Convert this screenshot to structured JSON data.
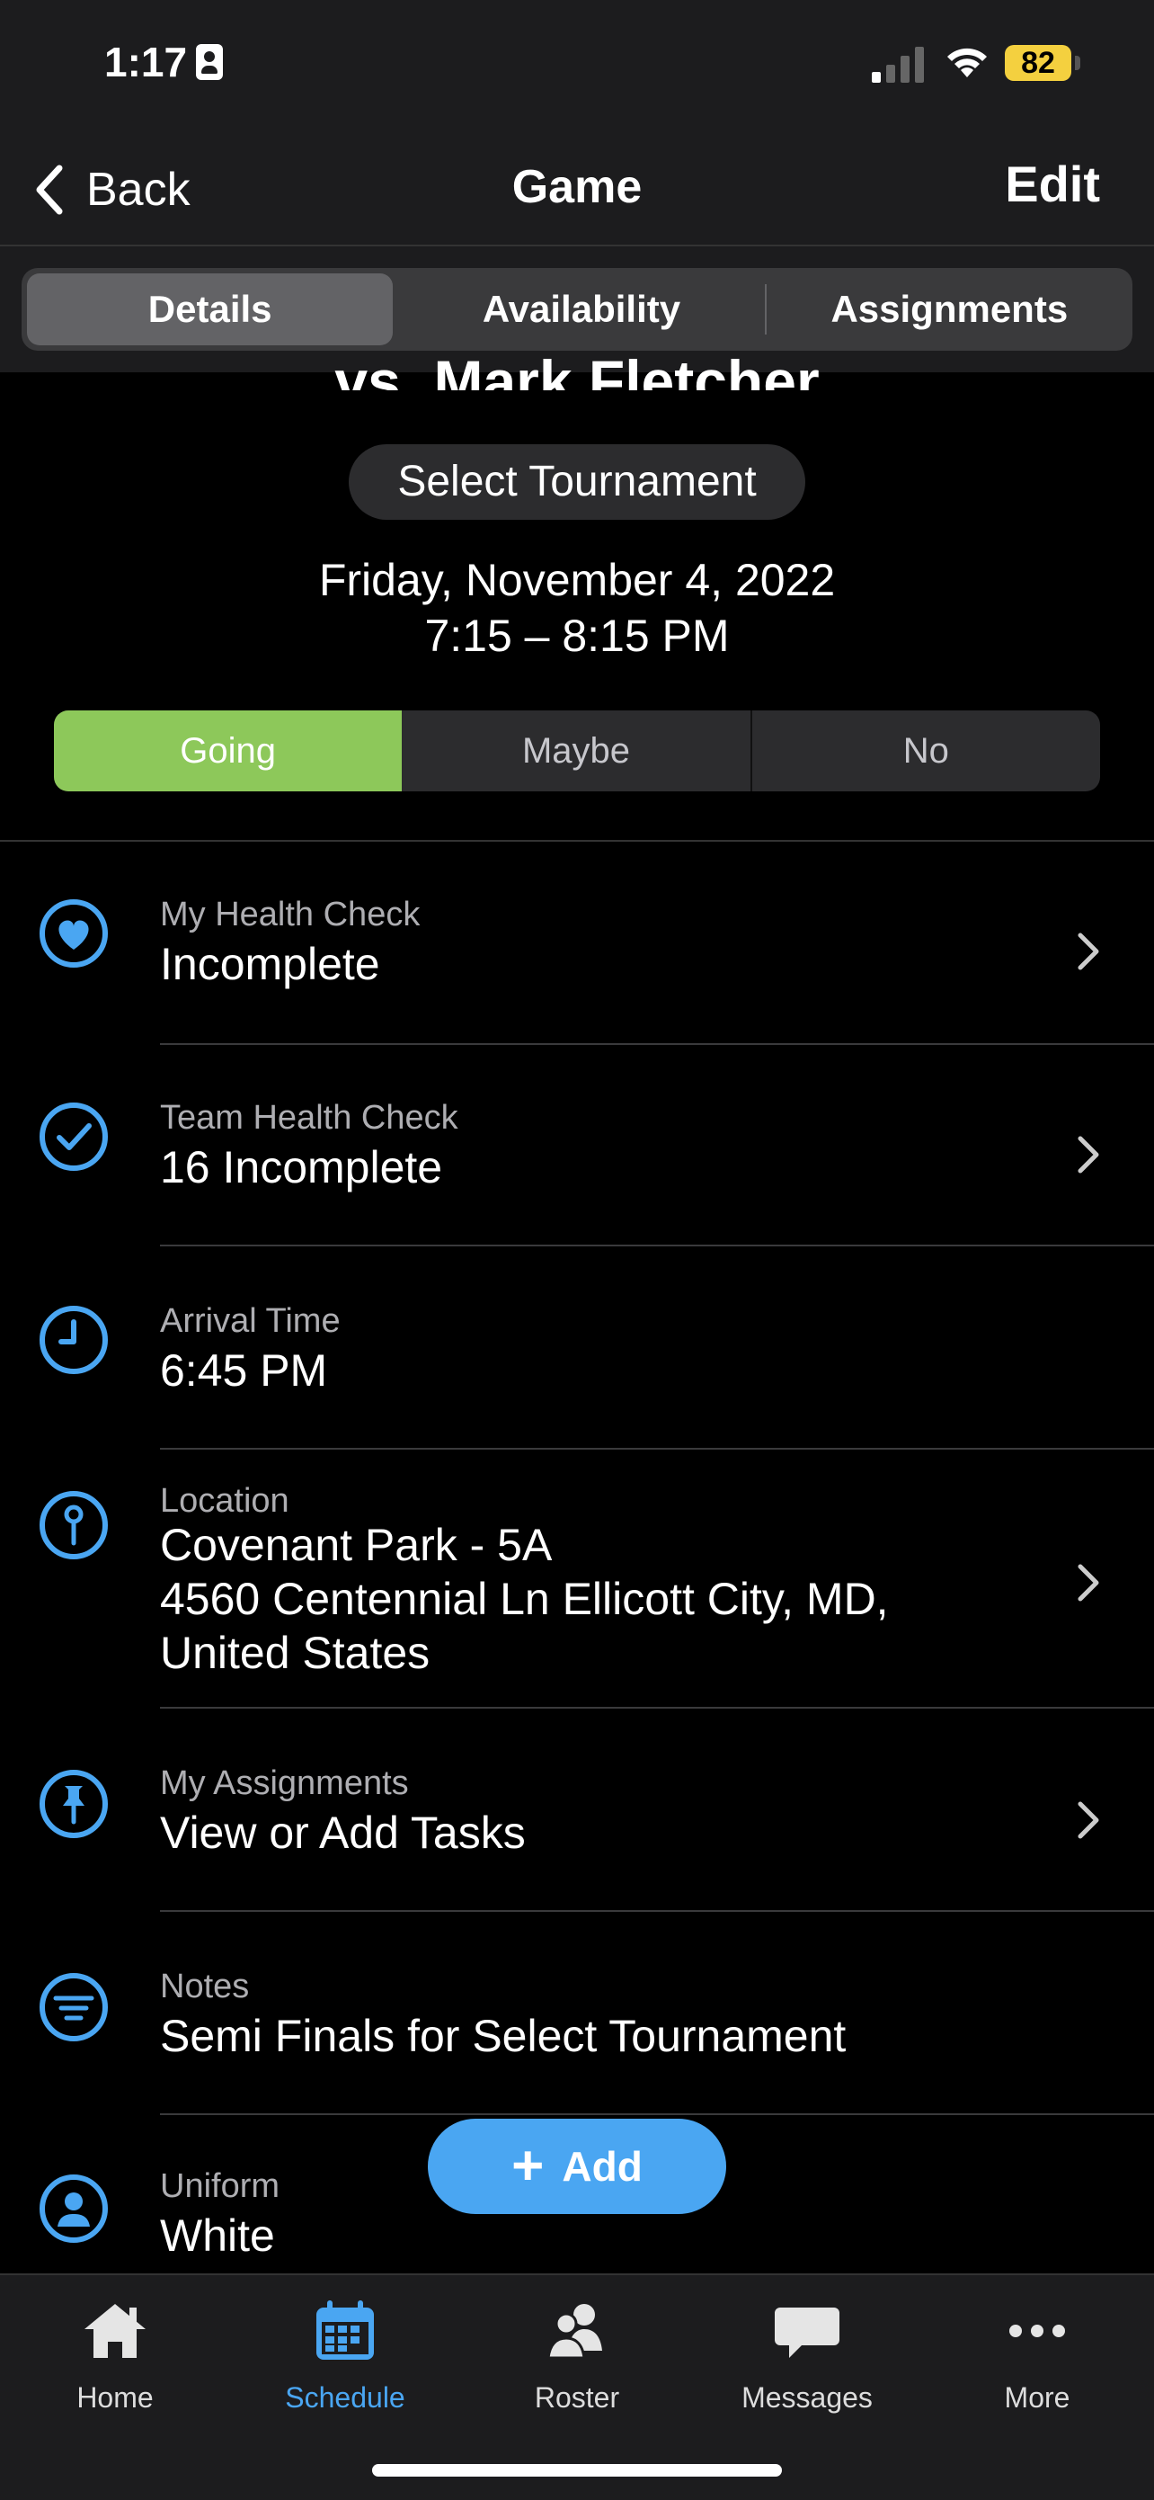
{
  "status_bar": {
    "time": "1:17",
    "battery": "82"
  },
  "nav": {
    "back_label": "Back",
    "title": "Game",
    "edit_label": "Edit"
  },
  "segments": [
    "Details",
    "Availability",
    "Assignments"
  ],
  "event": {
    "opponent": "vs. Mark Fletcher",
    "tournament_pill": "Select Tournament",
    "date": "Friday, November 4, 2022",
    "time_range": "7:15 – 8:15 PM"
  },
  "rsvp": {
    "going": "Going",
    "maybe": "Maybe",
    "no": "No",
    "selected": "Going"
  },
  "rows": [
    {
      "label": "My Health Check",
      "value": "Incomplete",
      "icon": "heart-icon"
    },
    {
      "label": "Team Health Check",
      "value": "16 Incomplete",
      "icon": "check-circle-icon"
    },
    {
      "label": "Arrival Time",
      "value": "6:45 PM",
      "icon": "clock-icon"
    },
    {
      "label": "Location",
      "value_lines": [
        "Covenant Park - 5A",
        "4560 Centennial Ln Ellicott City, MD,",
        "United States"
      ],
      "icon": "map-pin-icon"
    },
    {
      "label": "My Assignments",
      "value": "View or Add Tasks",
      "icon": "pushpin-icon"
    },
    {
      "label": "Notes",
      "value": "Semi Finals for Select Tournament",
      "icon": "notes-icon"
    },
    {
      "label": "Uniform",
      "value": "White",
      "icon": "person-icon"
    }
  ],
  "add_button": {
    "label": "Add"
  },
  "tabbar": [
    {
      "label": "Home",
      "icon": "house-icon"
    },
    {
      "label": "Schedule",
      "icon": "calendar-icon"
    },
    {
      "label": "Roster",
      "icon": "people-icon"
    },
    {
      "label": "Messages",
      "icon": "chat-bubble-icon"
    },
    {
      "label": "More",
      "icon": "ellipsis-icon"
    }
  ],
  "colors": {
    "accent": "#4aa6f2",
    "going": "#8dc85a",
    "background": "#000000",
    "bar": "#1c1c1e"
  }
}
